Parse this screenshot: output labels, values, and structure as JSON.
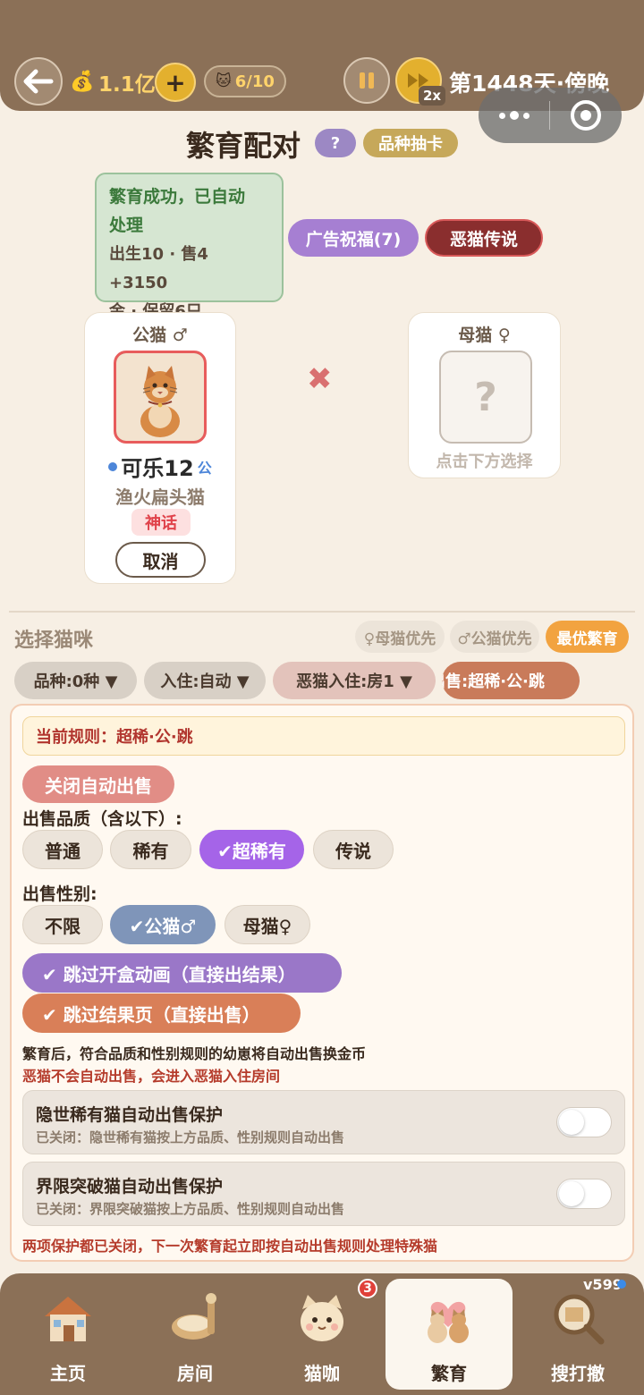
{
  "topbar": {
    "gold": "1.1亿",
    "plus": "+",
    "cat_count": "6/10",
    "speed_badge": "2x",
    "day": "第1448天·傍晚"
  },
  "header": {
    "title": "繁育配对",
    "help": "?",
    "gacha": "品种抽卡"
  },
  "result": {
    "title_line1": "繁育成功，已自动",
    "title_line2": "处理",
    "detail_line1": "出生10 · 售4 +3150",
    "detail_line2": "金 · 保留6只"
  },
  "actions": {
    "ad_blessing": "广告祝福(7)",
    "evil_legend": "恶猫传说"
  },
  "male": {
    "label": "公猫 ♂",
    "name": "可乐12",
    "sex": "公",
    "breed": "渔火扁头猫",
    "rarity": "神话",
    "cancel": "取消"
  },
  "cross": "✖",
  "female": {
    "label": "母猫 ♀",
    "placeholder": "?",
    "hint": "点击下方选择"
  },
  "select": {
    "title": "选择猫咪",
    "female_first": "♀母猫优先",
    "male_first": "♂公猫优先",
    "best_breed": "最优繁育"
  },
  "filters": {
    "breed": "品种:0种 ▼",
    "checkin": "入住:自动 ▼",
    "evil_checkin": "恶猫入住:房1 ▼",
    "sale": "出售:超稀·公·跳"
  },
  "panel": {
    "current_rule": "当前规则：超稀·公·跳",
    "close_auto_sale": "关闭自动出售",
    "quality_label": "出售品质（含以下）:",
    "quality_options": [
      "普通",
      "稀有",
      "✔超稀有",
      "传说"
    ],
    "gender_label": "出售性别:",
    "gender_options": [
      "不限",
      "✔公猫♂",
      "母猫♀"
    ],
    "skip_animation": "✔ 跳过开盒动画（直接出结果）",
    "skip_result": "✔ 跳过结果页（直接出售）",
    "info1": "繁育后，符合品质和性别规则的幼崽将自动出售换金币",
    "info2": "恶猫不会自动出售，会进入恶猫入住房间",
    "protect1_title": "隐世稀有猫自动出售保护",
    "protect1_sub": "已关闭：隐世稀有猫按上方品质、性别规则自动出售",
    "protect2_title": "界限突破猫自动出售保护",
    "protect2_sub": "已关闭：界限突破猫按上方品质、性别规则自动出售",
    "footer_note": "两项保护都已关闭，下一次繁育起立即按自动出售规则处理特殊猫"
  },
  "nav": {
    "items": [
      {
        "label": "主页",
        "icon": "house-icon"
      },
      {
        "label": "房间",
        "icon": "room-icon"
      },
      {
        "label": "猫咖",
        "icon": "cat-cafe-icon"
      },
      {
        "label": "繁育",
        "icon": "breeding-icon"
      },
      {
        "label": "搜打撤",
        "icon": "search-map-icon"
      }
    ],
    "cafe_badge": "3",
    "version": "v599"
  }
}
